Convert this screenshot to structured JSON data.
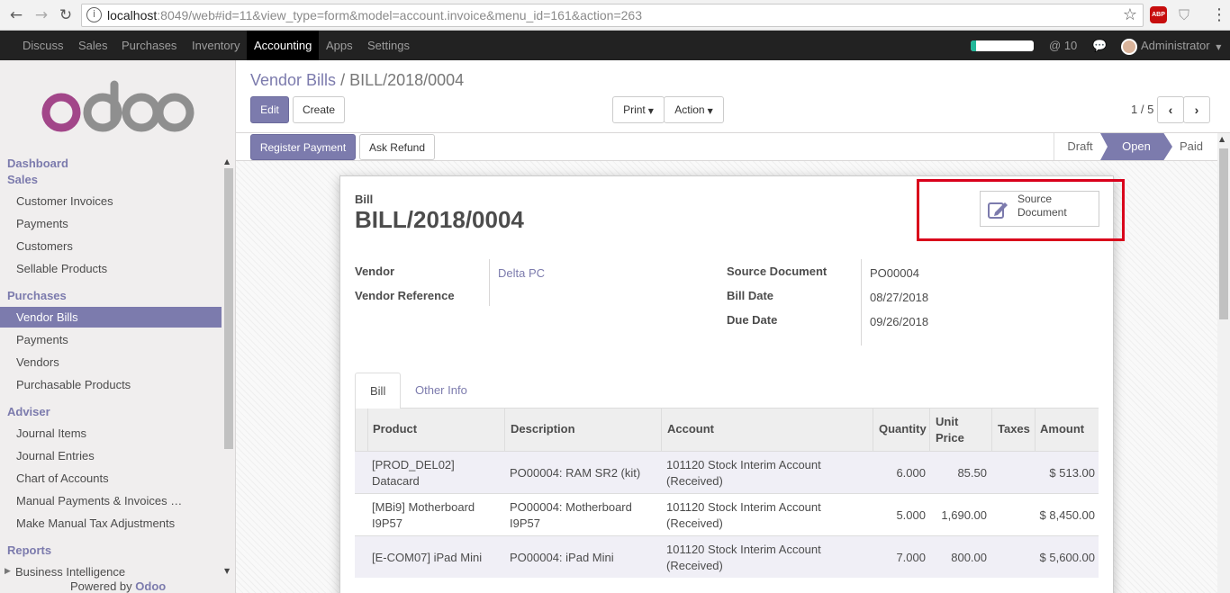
{
  "browser": {
    "url_host": "localhost",
    "url_rest": ":8049/web#id=11&view_type=form&model=account.invoice&menu_id=161&action=263",
    "ext_abp": "ABP"
  },
  "topmenu": {
    "items": [
      "Discuss",
      "Sales",
      "Purchases",
      "Inventory",
      "Accounting",
      "Apps",
      "Settings"
    ],
    "active": "Accounting",
    "messages_count": "10",
    "user": "Administrator",
    "progress": 0.08,
    "accent_color": "#7c7bad"
  },
  "sidebar": {
    "dashboard": "Dashboard",
    "sales_head": "Sales",
    "sales_items": [
      "Customer Invoices",
      "Payments",
      "Customers",
      "Sellable Products"
    ],
    "purchases_head": "Purchases",
    "purchases_items": [
      "Vendor Bills",
      "Payments",
      "Vendors",
      "Purchasable Products"
    ],
    "adviser_head": "Adviser",
    "adviser_items": [
      "Journal Items",
      "Journal Entries",
      "Chart of Accounts",
      "Manual Payments & Invoices …",
      "Make Manual Tax Adjustments"
    ],
    "reports_head": "Reports",
    "reports_items": [
      "Business Intelligence"
    ],
    "powered_prefix": "Powered by",
    "powered_brand": "Odoo"
  },
  "control": {
    "breadcrumb_parent": "Vendor Bills",
    "breadcrumb_sep": "/",
    "breadcrumb_current": "BILL/2018/0004",
    "edit": "Edit",
    "create": "Create",
    "print": "Print",
    "action": "Action",
    "pager": "1 / 5"
  },
  "statusbar": {
    "register_payment": "Register Payment",
    "ask_refund": "Ask Refund",
    "states": [
      "Draft",
      "Open",
      "Paid"
    ],
    "current_state": "Open"
  },
  "form": {
    "doc_label": "Bill",
    "doc_title": "BILL/2018/0004",
    "smart_button_line1": "Source",
    "smart_button_line2": "Document",
    "vendor_label": "Vendor",
    "vendor_value": "Delta PC",
    "vendor_ref_label": "Vendor Reference",
    "source_doc_label": "Source Document",
    "source_doc_value": "PO00004",
    "bill_date_label": "Bill Date",
    "bill_date_value": "08/27/2018",
    "due_date_label": "Due Date",
    "due_date_value": "09/26/2018",
    "tab_bill": "Bill",
    "tab_other": "Other Info"
  },
  "lines": {
    "headers": {
      "product": "Product",
      "description": "Description",
      "account": "Account",
      "quantity": "Quantity",
      "unit_price_1": "Unit",
      "unit_price_2": "Price",
      "taxes": "Taxes",
      "amount": "Amount"
    },
    "rows": [
      {
        "product_1": "[PROD_DEL02]",
        "product_2": "Datacard",
        "description_1": "PO00004: RAM SR2 (kit)",
        "description_2": "",
        "account_1": "101120 Stock Interim Account",
        "account_2": "(Received)",
        "quantity": "6.000",
        "unit_price": "85.50",
        "taxes": "",
        "amount": "$ 513.00"
      },
      {
        "product_1": "[MBi9] Motherboard",
        "product_2": "I9P57",
        "description_1": "PO00004: Motherboard",
        "description_2": "I9P57",
        "account_1": "101120 Stock Interim Account",
        "account_2": "(Received)",
        "quantity": "5.000",
        "unit_price": "1,690.00",
        "taxes": "",
        "amount": "$ 8,450.00"
      },
      {
        "product_1": "[E-COM07] iPad Mini",
        "product_2": "",
        "description_1": "PO00004: iPad Mini",
        "description_2": "",
        "account_1": "101120 Stock Interim Account",
        "account_2": "(Received)",
        "quantity": "7.000",
        "unit_price": "800.00",
        "taxes": "",
        "amount": "$ 5,600.00"
      }
    ]
  }
}
